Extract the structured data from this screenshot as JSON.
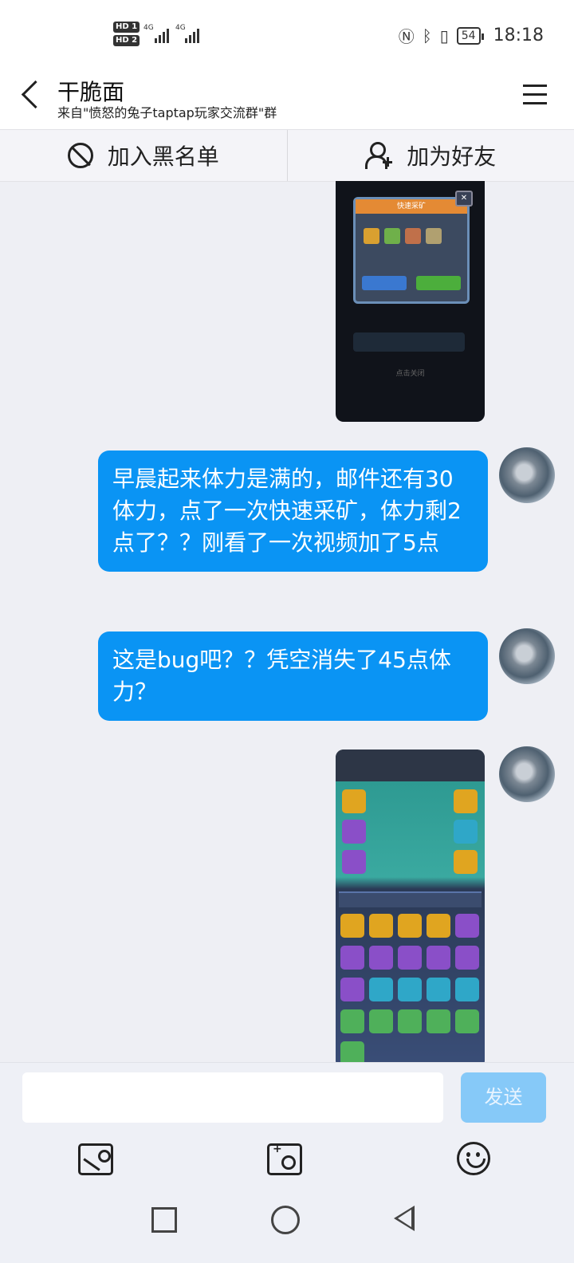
{
  "status_bar": {
    "hd1": "HD 1",
    "hd2": "HD 2",
    "network1": "4G",
    "network2": "4G",
    "battery": "54",
    "time": "18:18"
  },
  "header": {
    "title": "干脆面",
    "subtitle": "来自\"愤怒的兔子taptap玩家交流群\"群"
  },
  "actions": {
    "block_label": "加入黑名单",
    "add_friend_label": "加为好友"
  },
  "messages": [
    {
      "type": "image",
      "caption": "点击关闭"
    },
    {
      "type": "text",
      "text": "早晨起来体力是满的，邮件还有30体力，点了一次快速采矿，体力剩2点了？？刚看了一次视频加了5点"
    },
    {
      "type": "text",
      "text": "这是bug吧？？凭空消失了45点体力？"
    },
    {
      "type": "image"
    }
  ],
  "image1_popup": {
    "title": "快速采矿",
    "close": "✕"
  },
  "input": {
    "placeholder": "",
    "send_label": "发送"
  },
  "toolbar": {
    "icons": [
      "image-icon",
      "camera-icon",
      "emoji-icon"
    ]
  },
  "colors": {
    "bubble": "#0a94f4",
    "send_disabled": "#86c9f8"
  }
}
